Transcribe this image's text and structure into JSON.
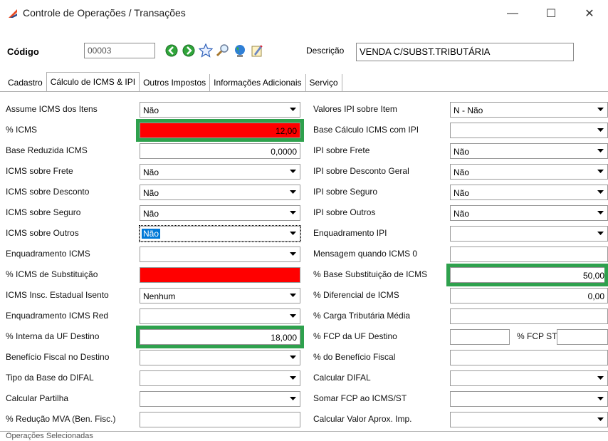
{
  "window": {
    "title": "Controle de Operações / Transações",
    "minimize": "—",
    "maximize": "☐",
    "close": "✕",
    "icon_color": "#e84a23"
  },
  "header": {
    "code_label": "Código",
    "code_value": "00003",
    "desc_label": "Descrição",
    "desc_value": "VENDA C/SUBST.TRIBUTÁRIA"
  },
  "tabs": [
    "Cadastro",
    "Cálculo de ICMS & IPI",
    "Outros Impostos",
    "Informações Adicionais",
    "Serviço"
  ],
  "left": [
    {
      "label": "Assume ICMS dos Itens",
      "value": "Não",
      "kind": "select"
    },
    {
      "label": "% ICMS",
      "value": "12,00",
      "kind": "number",
      "bg": "#ff0000",
      "highlight": true
    },
    {
      "label": "Base Reduzida ICMS",
      "value": "0,0000",
      "kind": "number"
    },
    {
      "label": "ICMS sobre Frete",
      "value": "Não",
      "kind": "select"
    },
    {
      "label": "ICMS sobre Desconto",
      "value": "Não",
      "kind": "select"
    },
    {
      "label": "ICMS sobre Seguro",
      "value": "Não",
      "kind": "select"
    },
    {
      "label": "ICMS sobre Outros",
      "value": "Não",
      "kind": "select",
      "selected": true
    },
    {
      "label": "Enquadramento ICMS",
      "value": "",
      "kind": "select"
    },
    {
      "label": "% ICMS de Substituição",
      "value": "",
      "kind": "number",
      "bg": "#ff0000"
    },
    {
      "label": "ICMS Insc. Estadual Isento",
      "value": "Nenhum",
      "kind": "select"
    },
    {
      "label": "Enquadramento ICMS Red",
      "value": "",
      "kind": "select"
    },
    {
      "label": "% Interna da UF Destino",
      "value": "18,000",
      "kind": "number",
      "highlight": true
    },
    {
      "label": "Benefício Fiscal no Destino",
      "value": "",
      "kind": "select"
    },
    {
      "label": "Tipo da Base do DIFAL",
      "value": "",
      "kind": "select"
    },
    {
      "label": "Calcular Partilha",
      "value": "",
      "kind": "select"
    },
    {
      "label": "% Redução MVA (Ben. Fisc.)",
      "value": "",
      "kind": "number"
    }
  ],
  "right": [
    {
      "label": "Valores IPI sobre Item",
      "value": "N - Não",
      "kind": "select"
    },
    {
      "label": "Base Cálculo ICMS com IPI",
      "value": "",
      "kind": "select"
    },
    {
      "label": "IPI sobre Frete",
      "value": "Não",
      "kind": "select"
    },
    {
      "label": "IPI sobre Desconto Geral",
      "value": "Não",
      "kind": "select"
    },
    {
      "label": "IPI sobre Seguro",
      "value": "Não",
      "kind": "select"
    },
    {
      "label": "IPI sobre Outros",
      "value": "Não",
      "kind": "select"
    },
    {
      "label": "Enquadramento IPI",
      "value": "",
      "kind": "select"
    },
    {
      "label": "Mensagem quando ICMS 0",
      "value": "",
      "kind": "text"
    },
    {
      "label": "% Base Substituição de ICMS",
      "value": "50,00",
      "kind": "number",
      "highlight": true
    },
    {
      "label": "% Diferencial de ICMS",
      "value": "0,00",
      "kind": "number"
    },
    {
      "label": "% Carga Tributária Média",
      "value": "",
      "kind": "text"
    },
    {
      "label": "% FCP da UF Destino",
      "value": "",
      "kind": "text",
      "extra_label": "% FCP ST",
      "extra_value": ""
    },
    {
      "label": "% do Benefício Fiscal",
      "value": "",
      "kind": "text"
    },
    {
      "label": "Calcular DIFAL",
      "value": "",
      "kind": "select"
    },
    {
      "label": "Somar FCP ao ICMS/ST",
      "value": "",
      "kind": "select"
    },
    {
      "label": "Calcular Valor Aprox. Imp.",
      "value": "",
      "kind": "select"
    }
  ],
  "status_text": "Operações Selecionadas",
  "highlight_color": "#2ea14d"
}
